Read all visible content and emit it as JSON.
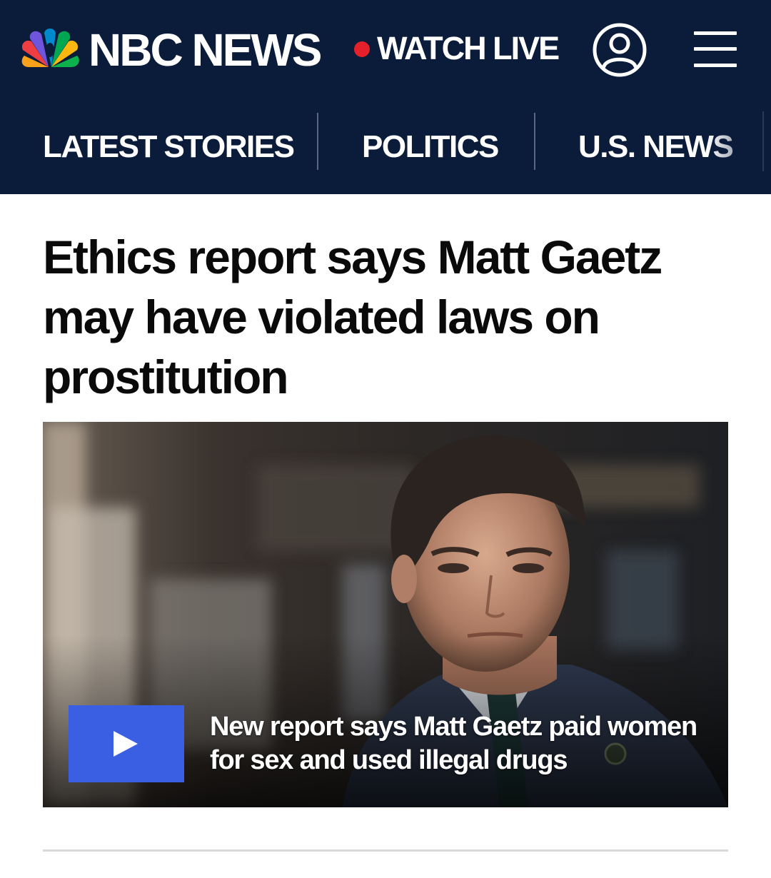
{
  "header": {
    "brand": "NBC NEWS",
    "watch_live": "WATCH LIVE",
    "account_icon": "account-circle-icon",
    "menu_icon": "hamburger-menu-icon",
    "logo_icon": "peacock-logo-icon",
    "live_indicator_color": "#e4202a",
    "background_color": "#0b1c3a"
  },
  "nav": {
    "items": [
      {
        "label": "LATEST STORIES"
      },
      {
        "label": "POLITICS"
      },
      {
        "label": "U.S. NEWS"
      }
    ]
  },
  "article": {
    "headline": "Ethics report says Matt Gaetz may have violated laws on prostitution",
    "video": {
      "caption": "New report says Matt Gaetz paid women for sex and used illegal drugs",
      "play_icon": "play-icon",
      "play_button_color": "#3a5fe3"
    }
  }
}
